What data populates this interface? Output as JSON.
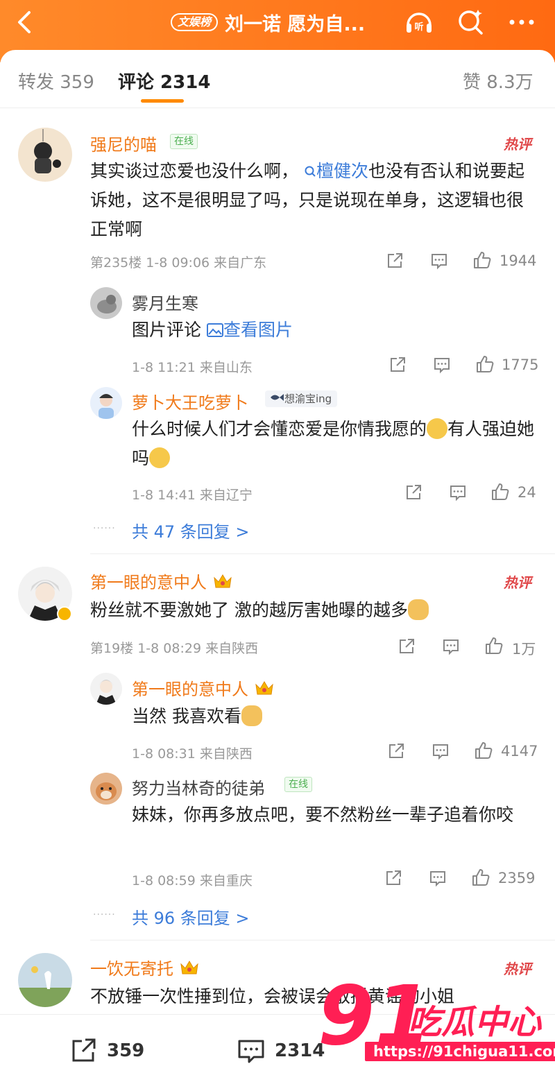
{
  "header": {
    "tag": "文娱榜",
    "title": "刘一诺 愿为自...",
    "colors": {
      "bar": "#ff7a1e"
    },
    "icons": [
      "back-icon",
      "listen-icon",
      "search-icon",
      "more-icon"
    ],
    "listen_label": "听"
  },
  "tabs": {
    "repost": "转发 359",
    "comments": "评论 2314",
    "likes": "赞 8.3万"
  },
  "comments": [
    {
      "user": "强尼的喵",
      "online": "在线",
      "hot": "热评",
      "text_a": "其实谈过恋爱也没什么啊，",
      "link": "檀健次",
      "text_b": "也没有否认和说要起诉她，这不是很明显了吗，只是说现在单身，这逻辑也很正常啊",
      "meta": "第235楼 1-8 09:06 来自广东",
      "likes": "1944",
      "replies": [
        {
          "user": "雾月生寒",
          "text": "图片评论",
          "pic_link": "查看图片",
          "meta": "1-8 11:21 来自山东",
          "likes": "1775"
        },
        {
          "user": "萝卜大王吃萝卜",
          "tag": "想渝宝ing",
          "text_a": "什么时候人们才会懂恋爱是你情我愿的",
          "text_b": "有人强迫她吗",
          "meta": "1-8 14:41 来自辽宁",
          "likes": "24"
        }
      ],
      "more": "共 47 条回复 >"
    },
    {
      "user": "第一眼的意中人",
      "hot": "热评",
      "text": "粉丝就不要激她了 激的越厉害她曝的越多",
      "meta": "第19楼 1-8 08:29 来自陕西",
      "likes": "1万",
      "replies": [
        {
          "user": "第一眼的意中人",
          "text": "当然 我喜欢看",
          "meta": "1-8 08:31 来自陕西",
          "likes": "4147"
        },
        {
          "user": "努力当林奇的徒弟",
          "online": "在线",
          "text": "妹妹，你再多放点吧，要不然粉丝一辈子追着你咬",
          "meta": "1-8 08:59 来自重庆",
          "likes": "2359"
        }
      ],
      "more": "共 96 条回复 >"
    },
    {
      "user": "一饮无寄托",
      "hot": "热评",
      "text": "不放锤一次性捶到位，会被误会散播黄谣的小姐"
    }
  ],
  "bottom": {
    "repost": "359",
    "comments": "2314"
  },
  "watermark": {
    "num": "91",
    "cn": "吃瓜中心",
    "url": "https://91chigua11.com"
  }
}
